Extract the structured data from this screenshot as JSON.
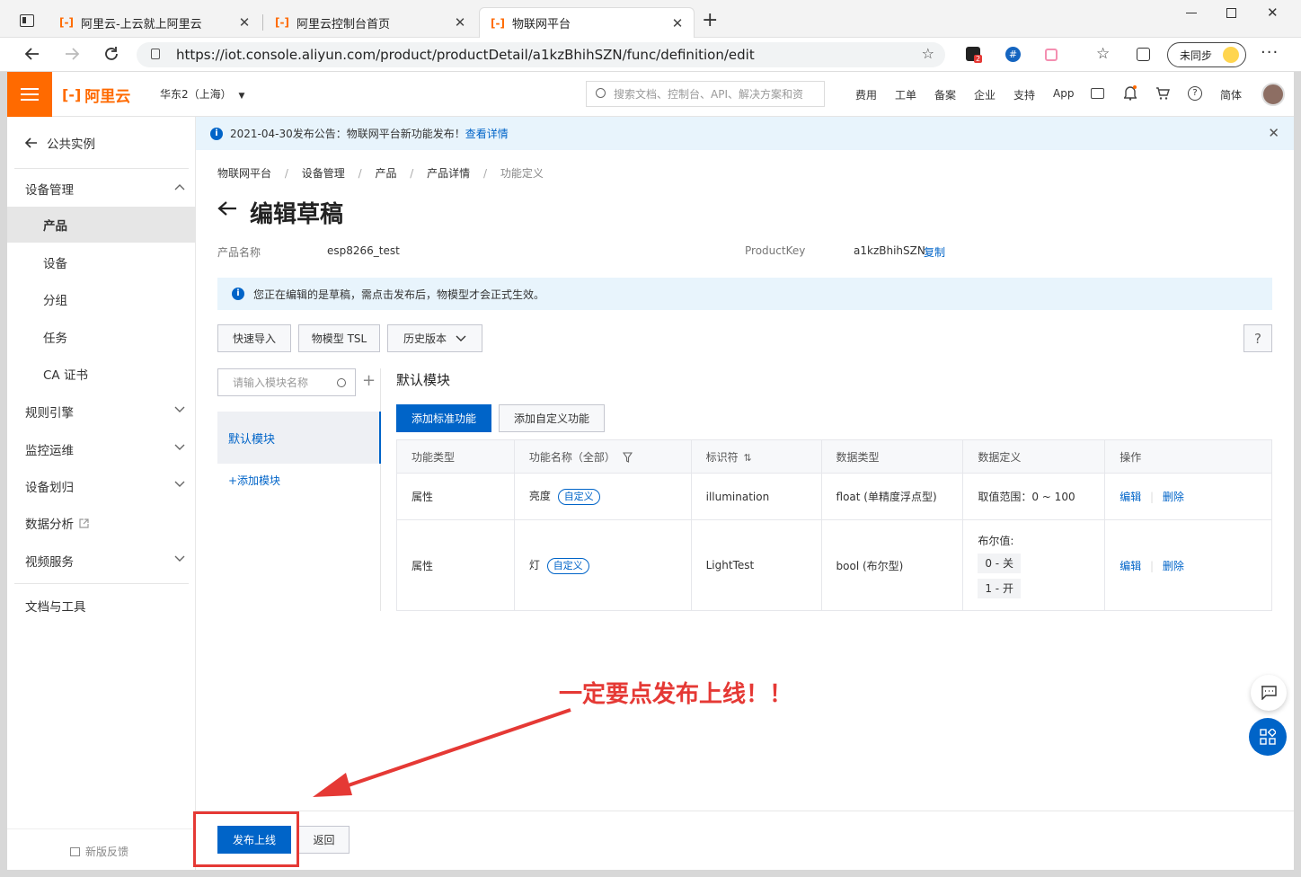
{
  "browser": {
    "tabs": [
      {
        "title": "阿里云-上云就上阿里云"
      },
      {
        "title": "阿里云控制台首页"
      },
      {
        "title": "物联网平台"
      }
    ],
    "url": "https://iot.console.aliyun.com/product/productDetail/a1kzBhihSZN/func/definition/edit",
    "sync_label": "未同步",
    "ext_badge": "2"
  },
  "header": {
    "brand": "阿里云",
    "region": "华东2（上海）",
    "search_placeholder": "搜索文档、控制台、API、解决方案和资",
    "nav": [
      "费用",
      "工单",
      "备案",
      "企业",
      "支持",
      "App"
    ],
    "lang": "简体"
  },
  "sidebar": {
    "back_label": "公共实例",
    "group_label": "设备管理",
    "sub_items": [
      "产品",
      "设备",
      "分组",
      "任务",
      "CA 证书"
    ],
    "sections": [
      "规则引擎",
      "监控运维",
      "设备划归",
      "数据分析",
      "视频服务"
    ],
    "docs_label": "文档与工具",
    "feedback_label": "新版反馈"
  },
  "notice": {
    "text": "2021-04-30发布公告：物联网平台新功能发布！",
    "link": "查看详情"
  },
  "breadcrumb": [
    "物联网平台",
    "设备管理",
    "产品",
    "产品详情",
    "功能定义"
  ],
  "page": {
    "title": "编辑草稿",
    "product_name_label": "产品名称",
    "product_name": "esp8266_test",
    "product_key_label": "ProductKey",
    "product_key": "a1kzBhihSZN",
    "copy_label": "复制",
    "draft_notice": "您正在编辑的是草稿，需点击发布后，物模型才会正式生效。"
  },
  "toolbar": {
    "quick_import": "快速导入",
    "tsl": "物模型 TSL",
    "history": "历史版本",
    "help": "?"
  },
  "modules": {
    "search_placeholder": "请输入模块名称",
    "default_module": "默认模块",
    "add_module": "+添加模块",
    "panel_title": "默认模块",
    "add_std": "添加标准功能",
    "add_custom": "添加自定义功能"
  },
  "table": {
    "headers": [
      "功能类型",
      "功能名称（全部）",
      "标识符",
      "数据类型",
      "数据定义",
      "操作"
    ],
    "rows": [
      {
        "type": "属性",
        "name": "亮度",
        "tag": "自定义",
        "identifier": "illumination",
        "data_type": "float (单精度浮点型)",
        "definition": "取值范围：0 ~ 100",
        "edit": "编辑",
        "delete": "删除"
      },
      {
        "type": "属性",
        "name": "灯",
        "tag": "自定义",
        "identifier": "LightTest",
        "data_type": "bool (布尔型)",
        "def_label": "布尔值:",
        "def_values": [
          "0 - 关",
          "1 - 开"
        ],
        "edit": "编辑",
        "delete": "删除"
      }
    ]
  },
  "annotation": {
    "text": "一定要点发布上线！！",
    "color": "#e53935"
  },
  "footer": {
    "publish": "发布上线",
    "back": "返回"
  },
  "colors": {
    "brand": "#ff6a00",
    "primary": "#0064c8",
    "annotation": "#e53935"
  }
}
